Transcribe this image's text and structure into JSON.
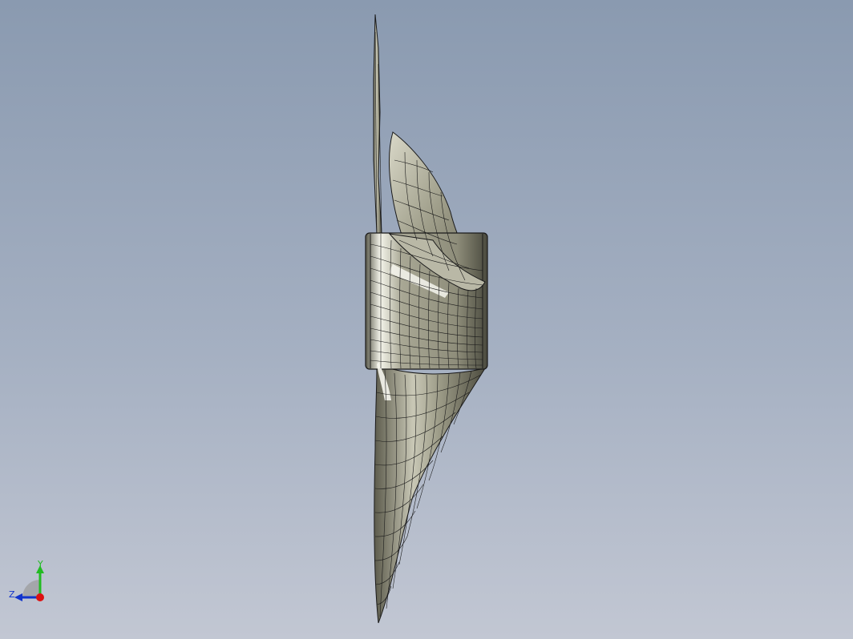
{
  "viewport": {
    "background_top": "#8a9ab0",
    "background_bottom": "#c2c7d3"
  },
  "model": {
    "icon": "propeller-model",
    "surface_color": "#a7a691",
    "edge_color": "#1a1a1a"
  },
  "triad": {
    "y_label": "Y",
    "z_label": "Z",
    "y_color": "#22bb22",
    "z_color": "#1133cc",
    "x_color": "#dd1111"
  }
}
